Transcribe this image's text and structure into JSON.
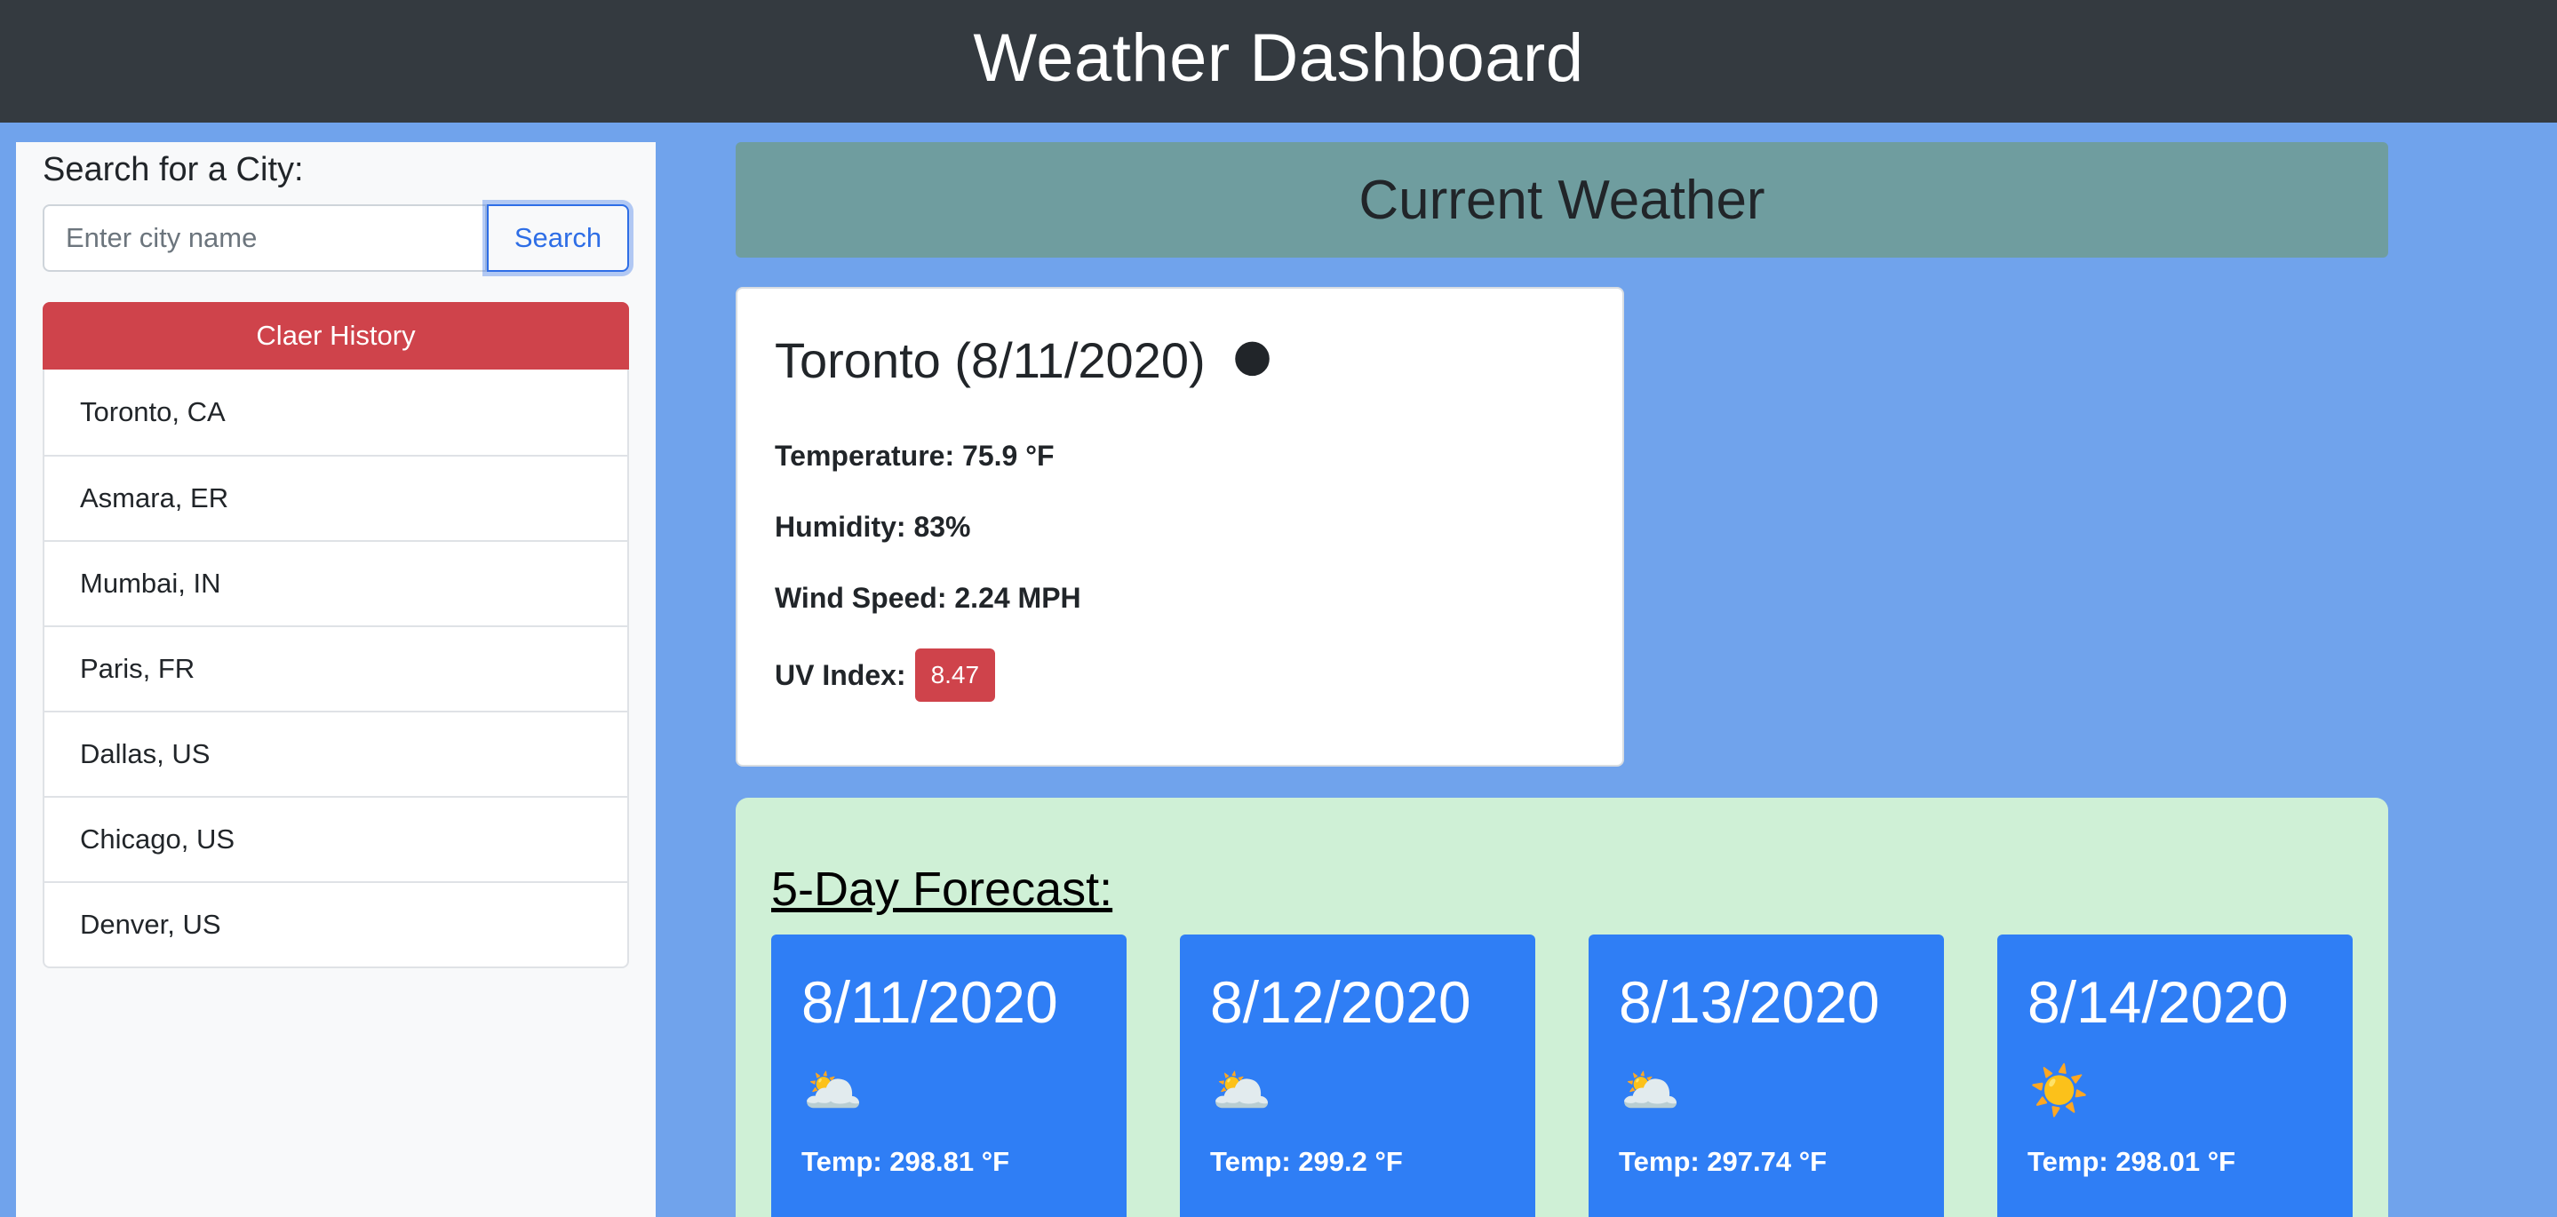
{
  "header": {
    "title": "Weather Dashboard"
  },
  "sidebar": {
    "search_label": "Search for a City:",
    "search_placeholder": "Enter city name",
    "search_button": "Search",
    "clear_button": "Claer History",
    "history": [
      "Toronto, CA",
      "Asmara, ER",
      "Mumbai, IN",
      "Paris, FR",
      "Dallas, US",
      "Chicago, US",
      "Denver, US"
    ]
  },
  "current": {
    "header": "Current Weather",
    "city": "Toronto (8/11/2020)",
    "icon": "🌑",
    "temperature": "Temperature: 75.9 °F",
    "humidity": "Humidity: 83%",
    "wind": "Wind Speed: 2.24 MPH",
    "uv_label": "UV Index:",
    "uv_value": "8.47",
    "uv_color": "#cf434b"
  },
  "forecast": {
    "title": "5-Day Forecast:",
    "days": [
      {
        "date": "8/11/2020",
        "icon": "🌥️",
        "temp": "Temp: 298.81 °F"
      },
      {
        "date": "8/12/2020",
        "icon": "🌥️",
        "temp": "Temp: 299.2 °F"
      },
      {
        "date": "8/13/2020",
        "icon": "🌥️",
        "temp": "Temp: 297.74 °F"
      },
      {
        "date": "8/14/2020",
        "icon": "☀️",
        "temp": "Temp: 298.01 °F"
      }
    ]
  },
  "colors": {
    "topbar": "#343a40",
    "page_bg": "#70a3ec",
    "current_header_bg": "#6f9d9f",
    "forecast_bg": "#cff0d6",
    "forecast_card_bg": "#2f7ef5",
    "danger": "#cf434b",
    "primary": "#2e6ee6"
  }
}
